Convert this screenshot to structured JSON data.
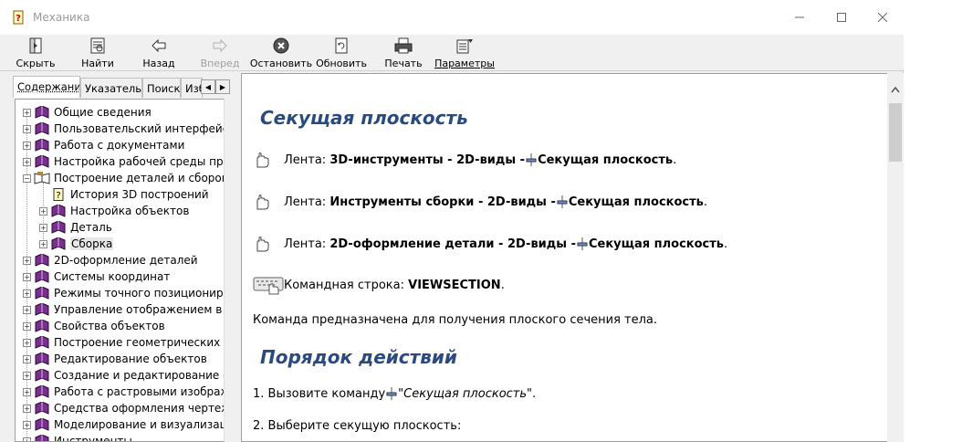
{
  "window": {
    "title": "Механика"
  },
  "toolbar": {
    "buttons": [
      {
        "label": "Скрыть",
        "icon": "hide-icon",
        "enabled": true
      },
      {
        "label": "Найти",
        "icon": "find-icon",
        "enabled": true
      },
      {
        "label": "Назад",
        "icon": "back-arrow-icon",
        "enabled": true
      },
      {
        "label": "Вперед",
        "icon": "forward-arrow-icon",
        "enabled": false
      },
      {
        "label": "Остановить",
        "icon": "stop-icon",
        "enabled": true
      },
      {
        "label": "Обновить",
        "icon": "refresh-icon",
        "enabled": true
      },
      {
        "label": "Печать",
        "icon": "print-icon",
        "enabled": true
      },
      {
        "label": "Параметры",
        "icon": "options-icon",
        "enabled": true
      }
    ]
  },
  "tabs": [
    {
      "label": "Содержание",
      "active": true
    },
    {
      "label": "Указатель",
      "active": false
    },
    {
      "label": "Поиск",
      "active": false
    },
    {
      "label": "Избранное",
      "active": false
    }
  ],
  "tree": [
    {
      "label": "Общие сведения",
      "level": 0,
      "type": "book"
    },
    {
      "label": "Пользовательский интерфейс программы",
      "level": 0,
      "type": "book"
    },
    {
      "label": "Работа с документами",
      "level": 0,
      "type": "book"
    },
    {
      "label": "Настройка рабочей среды программы",
      "level": 0,
      "type": "book"
    },
    {
      "label": "Построение деталей и сборок",
      "level": 0,
      "type": "book-open"
    },
    {
      "label": "История 3D построений",
      "level": 1,
      "type": "page"
    },
    {
      "label": "Настройка объектов",
      "level": 1,
      "type": "book"
    },
    {
      "label": "Деталь",
      "level": 1,
      "type": "book"
    },
    {
      "label": "Сборка",
      "level": 1,
      "type": "book",
      "selected": true
    },
    {
      "label": "2D-оформление деталей",
      "level": 0,
      "type": "book"
    },
    {
      "label": "Системы координат",
      "level": 0,
      "type": "book"
    },
    {
      "label": "Режимы точного позиционирования",
      "level": 0,
      "type": "book"
    },
    {
      "label": "Управление отображением в графической зоне",
      "level": 0,
      "type": "book"
    },
    {
      "label": "Свойства объектов",
      "level": 0,
      "type": "book"
    },
    {
      "label": "Построение геометрических объектов",
      "level": 0,
      "type": "book"
    },
    {
      "label": "Редактирование объектов",
      "level": 0,
      "type": "book"
    },
    {
      "label": "Создание и редактирование слоев",
      "level": 0,
      "type": "book"
    },
    {
      "label": "Работа с растровыми изображениями",
      "level": 0,
      "type": "book"
    },
    {
      "label": "Средства оформления чертежей",
      "level": 0,
      "type": "book"
    },
    {
      "label": "Моделирование и визуализация",
      "level": 0,
      "type": "book"
    },
    {
      "label": "Инструменты",
      "level": 0,
      "type": "book"
    }
  ],
  "content": {
    "heading1": "Секущая плоскость",
    "ribbon_lines": [
      {
        "prefix": "Лента: ",
        "path": "3D-инструменты - 2D-виды - ",
        "command": "Секущая плоскость",
        "suffix": "."
      },
      {
        "prefix": "Лента: ",
        "path": "Инструменты сборки - 2D-виды - ",
        "command": "Секущая плоскость",
        "suffix": "."
      },
      {
        "prefix": "Лента: ",
        "path": "2D-оформление детали - 2D-виды - ",
        "command": "Секущая плоскость",
        "suffix": "."
      }
    ],
    "cmdline": {
      "prefix": "Командная строка: ",
      "command": "VIEWSECTION",
      "suffix": "."
    },
    "description": "Команда предназначена для получения плоского сечения тела.",
    "heading2": "Порядок действий",
    "step1": {
      "prefix": "1. Вызовите команду ",
      "command": "\"Секущая плоскость\"",
      "suffix": "."
    },
    "step2": "2. Выберите секущую плоскость:"
  }
}
